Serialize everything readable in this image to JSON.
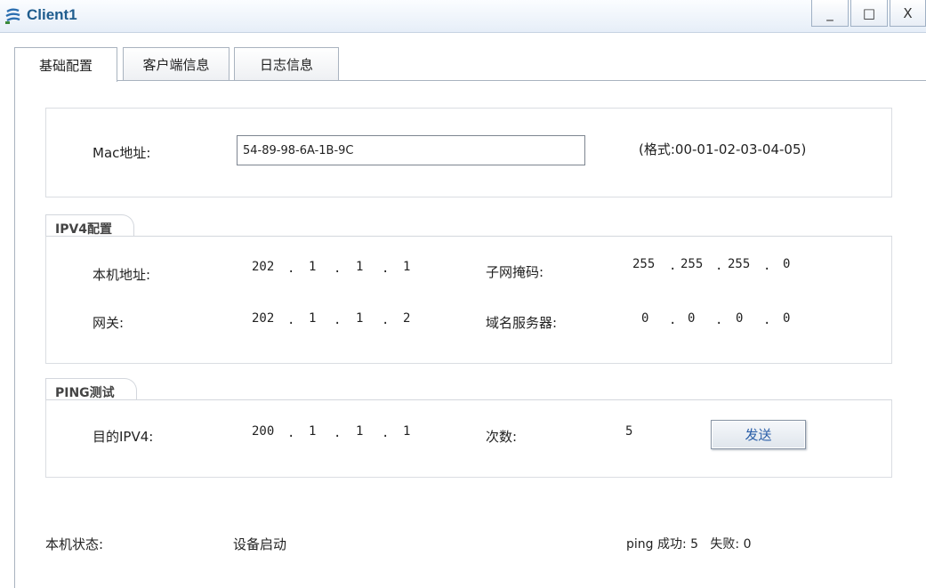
{
  "window": {
    "title": "Client1",
    "minimize_glyph": "_",
    "maximize_glyph": "□",
    "close_glyph": "X"
  },
  "tabs": [
    {
      "label": "基础配置",
      "active": true
    },
    {
      "label": "客户端信息",
      "active": false
    },
    {
      "label": "日志信息",
      "active": false
    }
  ],
  "mac": {
    "label": "Mac地址:",
    "value": "54-89-98-6A-1B-9C",
    "format_hint": "(格式:00-01-02-03-04-05)"
  },
  "ipv4": {
    "group_title": "IPV4配置",
    "local_address_label": "本机地址:",
    "local_address": [
      "202",
      "1",
      "1",
      "1"
    ],
    "subnet_mask_label": "子网掩码:",
    "subnet_mask": [
      "255",
      "255",
      "255",
      "0"
    ],
    "gateway_label": "网关:",
    "gateway": [
      "202",
      "1",
      "1",
      "2"
    ],
    "dns_label": "域名服务器:",
    "dns": [
      "0",
      "0",
      "0",
      "0"
    ]
  },
  "ping": {
    "group_title": "PING测试",
    "target_label": "目的IPV4:",
    "target": [
      "200",
      "1",
      "1",
      "1"
    ],
    "count_label": "次数:",
    "count": "5",
    "send_label": "发送"
  },
  "status": {
    "label": "本机状态:",
    "value": "设备启动",
    "result": "ping 成功: 5   失败: 0"
  },
  "icons": {
    "app": "client-app-icon"
  }
}
